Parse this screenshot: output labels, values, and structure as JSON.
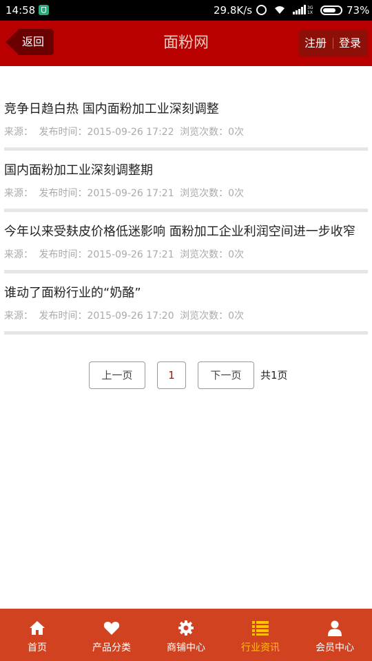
{
  "status": {
    "time": "14:58",
    "speed": "29.8K/s",
    "battery": "73%",
    "battery_level": 0.73
  },
  "header": {
    "back_label": "返回",
    "title": "面粉网",
    "register_label": "注册",
    "login_label": "登录"
  },
  "news": [
    {
      "title": "竞争日趋白热 国内面粉加工业深刻调整",
      "source_label": "来源：",
      "time_label": "发布时间：2015-09-26 17:22",
      "views_label": "浏览次数：0次"
    },
    {
      "title": "国内面粉加工业深刻调整期",
      "source_label": "来源：",
      "time_label": "发布时间：2015-09-26 17:21",
      "views_label": "浏览次数：0次"
    },
    {
      "title": "今年以来受麸皮价格低迷影响 面粉加工企业利润空间进一步收窄",
      "source_label": "来源：",
      "time_label": "发布时间：2015-09-26 17:21",
      "views_label": "浏览次数：0次"
    },
    {
      "title": "谁动了面粉行业的“奶酪”",
      "source_label": "来源：",
      "time_label": "发布时间：2015-09-26 17:20",
      "views_label": "浏览次数：0次"
    }
  ],
  "pagination": {
    "prev_label": "上一页",
    "current": "1",
    "next_label": "下一页",
    "total_label": "共1页"
  },
  "nav": [
    {
      "label": "首页",
      "icon": "home-icon"
    },
    {
      "label": "产品分类",
      "icon": "heart-icon"
    },
    {
      "label": "商铺中心",
      "icon": "gear-icon"
    },
    {
      "label": "行业资讯",
      "icon": "list-icon",
      "active": true
    },
    {
      "label": "会员中心",
      "icon": "user-icon"
    }
  ],
  "colors": {
    "header_bg": "#b90000",
    "nav_bg": "#d14320",
    "nav_active": "#ffc400"
  }
}
